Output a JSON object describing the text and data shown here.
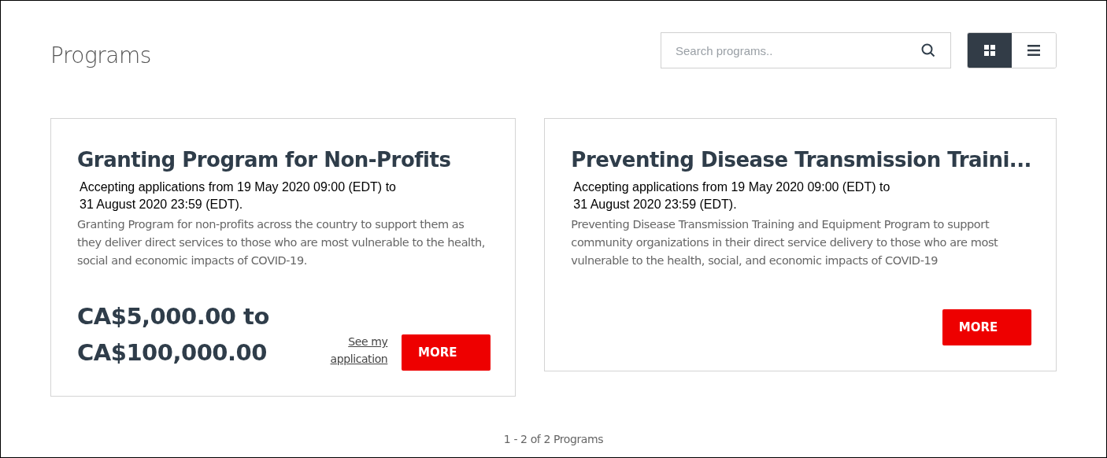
{
  "page_title": "Programs",
  "search": {
    "placeholder": "Search programs.."
  },
  "view_toggle": [
    {
      "kind": "grid",
      "selected": true
    },
    {
      "kind": "list",
      "selected": false
    }
  ],
  "programs": [
    {
      "title": "Granting Program for Non-Profits",
      "period": "Accepting applications from 19 May 2020 09:00 (EDT) to\n31 August 2020 23:59 (EDT).",
      "description": "Granting Program for non-profits across the country to support them as they deliver direct services to those who are most vulnerable to the health, social and economic impacts of COVID-19.",
      "amount": "CA$5,000.00 to CA$100,000.00",
      "application_link": "See my application",
      "button": "MORE"
    },
    {
      "title": "Preventing Disease Transmission Traini...",
      "period": "Accepting applications from 19 May 2020 09:00 (EDT) to\n31 August 2020 23:59 (EDT).",
      "description": "Preventing Disease Transmission Training and Equipment Program to support community organizations in their direct service delivery to those who are most vulnerable to the health, social, and economic impacts of COVID-19",
      "button": "MORE"
    }
  ],
  "footer": "1 - 2 of 2 Programs"
}
